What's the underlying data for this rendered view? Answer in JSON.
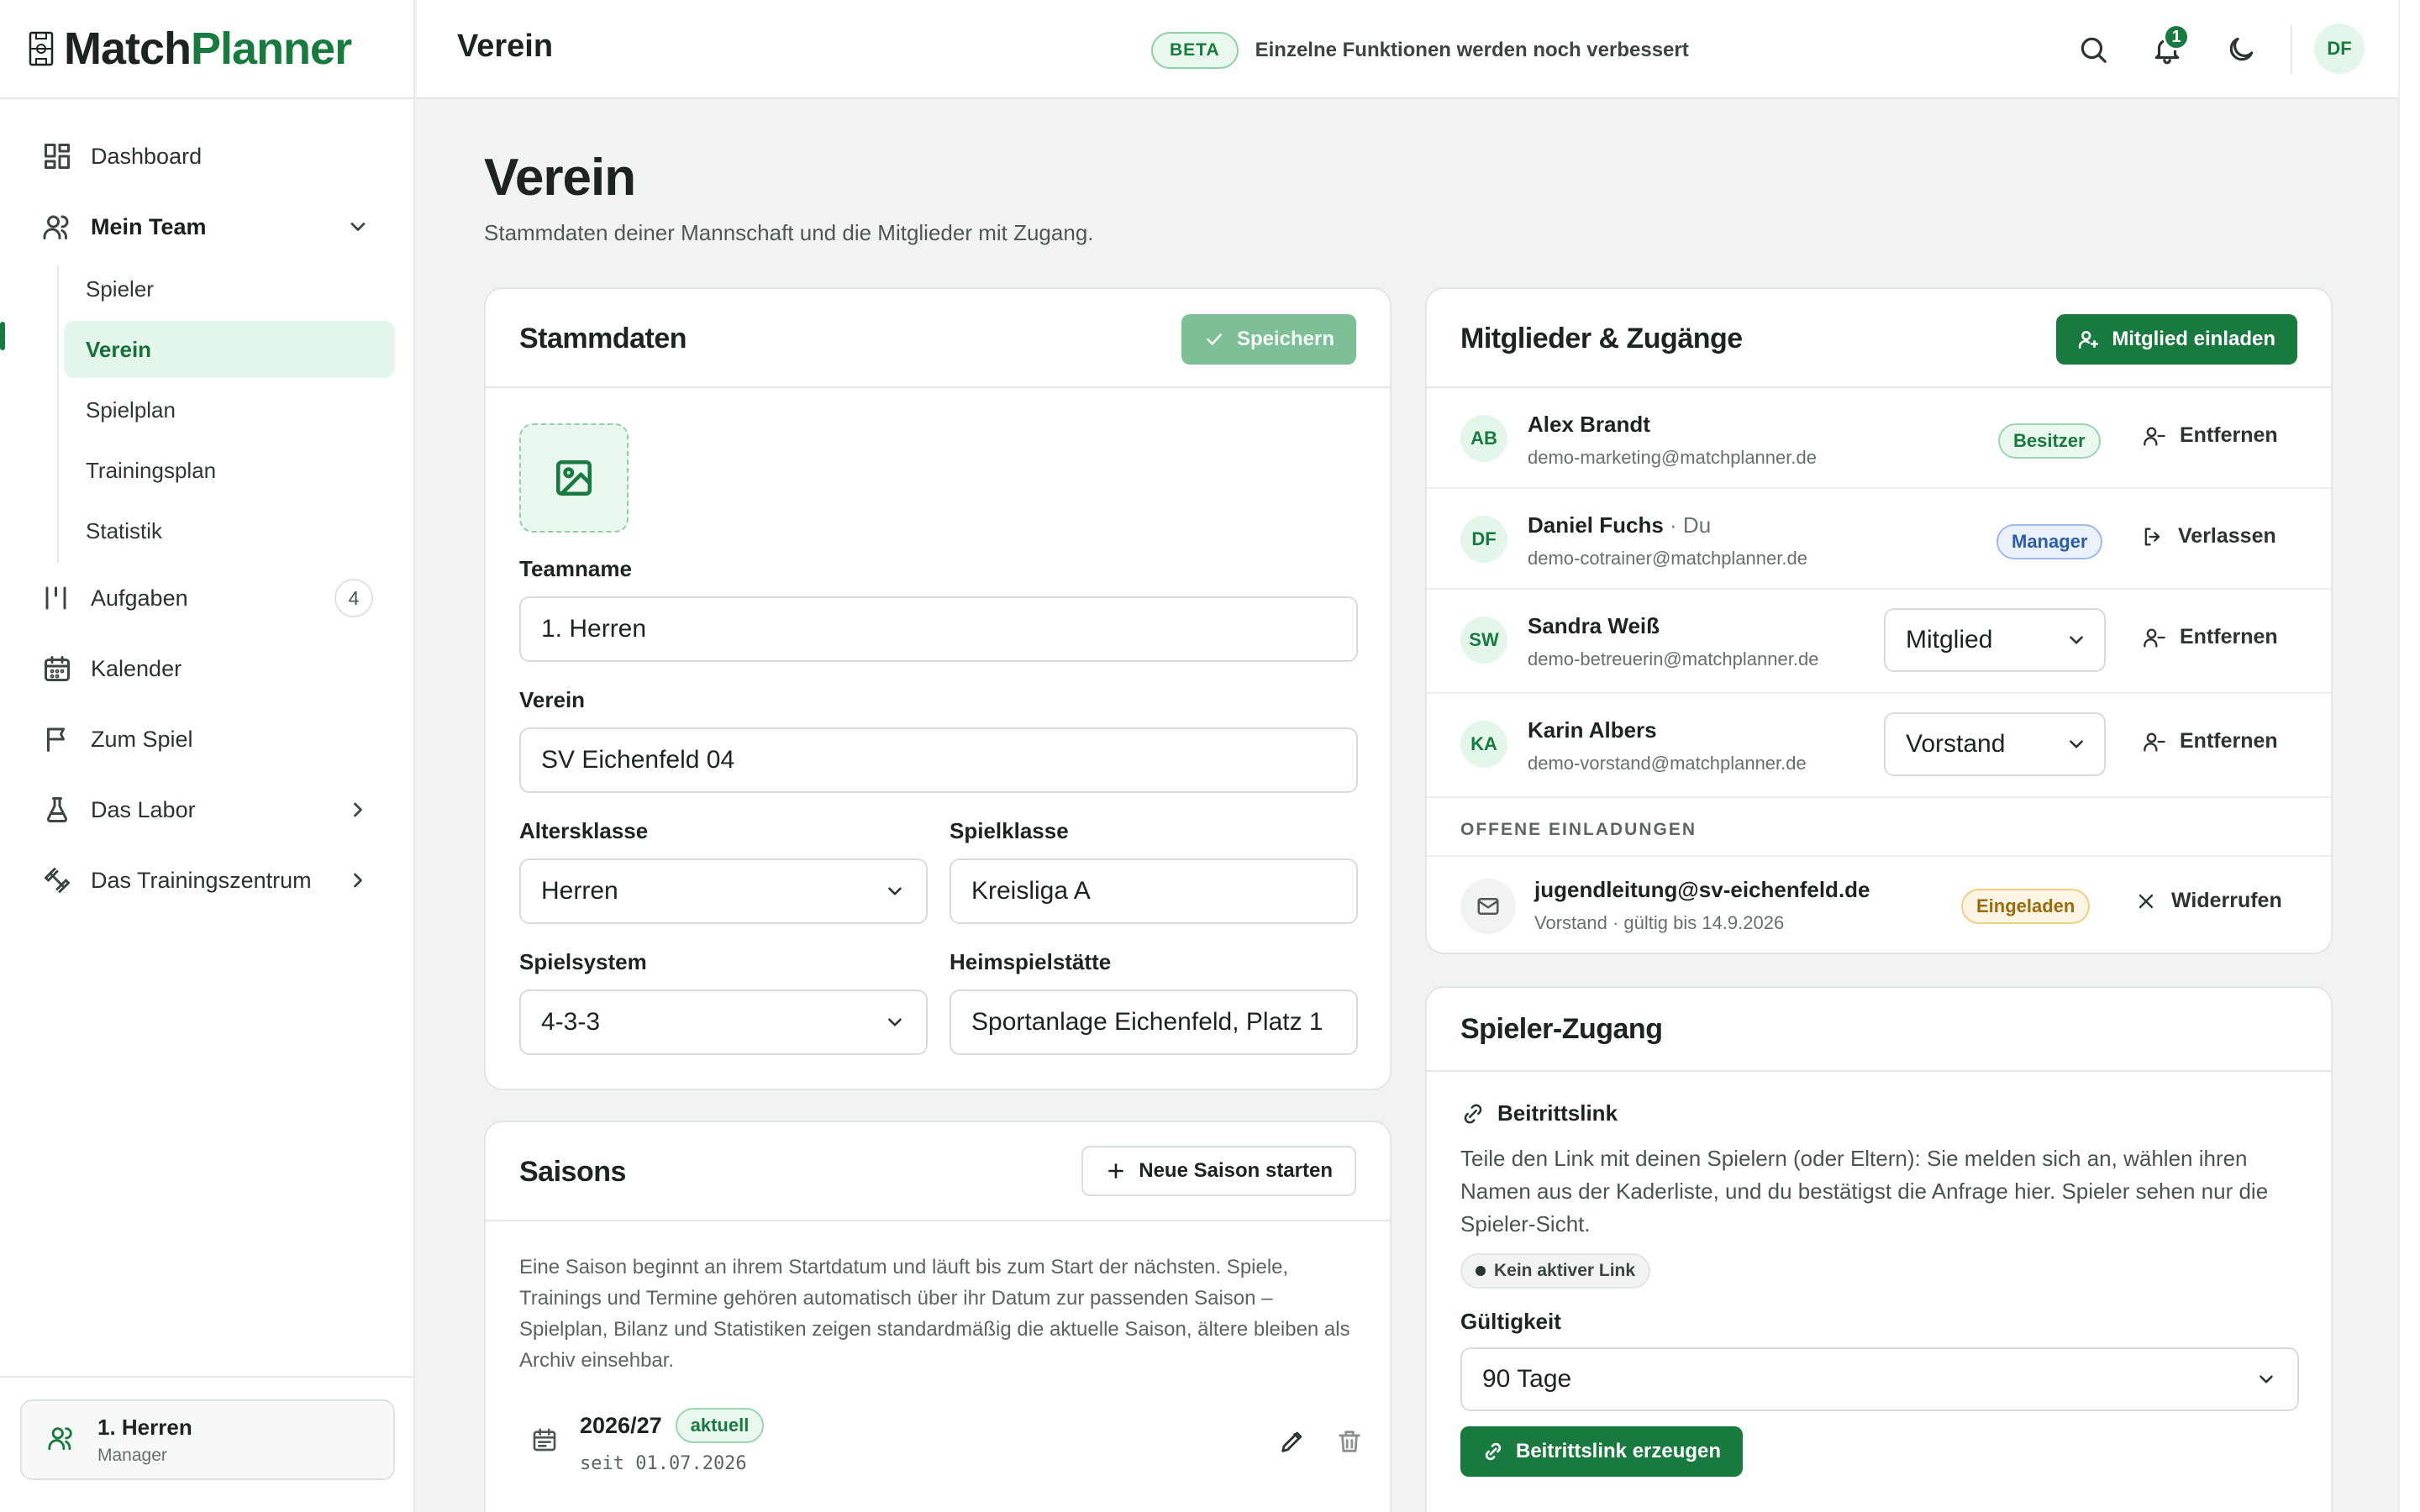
{
  "brand": {
    "part1": "Match",
    "part2": "Planner"
  },
  "topbar": {
    "title": "Verein",
    "beta_label": "BETA",
    "beta_text": "Einzelne Funktionen werden noch verbessert",
    "notification_count": "1",
    "user_initials": "DF",
    "icons": [
      "search-icon",
      "bell-icon",
      "moon-icon"
    ]
  },
  "sidebar": {
    "nav": {
      "dashboard": "Dashboard",
      "mein_team": "Mein Team",
      "aufgaben": "Aufgaben",
      "aufgaben_count": "4",
      "kalender": "Kalender",
      "zum_spiel": "Zum Spiel",
      "labor": "Das Labor",
      "trainingszentrum": "Das Trainingszentrum"
    },
    "subnav": [
      "Spieler",
      "Verein",
      "Spielplan",
      "Trainingsplan",
      "Statistik"
    ],
    "active_subnav": "Verein",
    "team_switch": {
      "name": "1. Herren",
      "role": "Manager"
    }
  },
  "page": {
    "title": "Verein",
    "subtitle": "Stammdaten deiner Mannschaft und die Mitglieder mit Zugang."
  },
  "stammdaten": {
    "title": "Stammdaten",
    "save_label": "Speichern",
    "fields": {
      "teamname_label": "Teamname",
      "teamname_value": "1. Herren",
      "verein_label": "Verein",
      "verein_value": "SV Eichenfeld 04",
      "altersklasse_label": "Altersklasse",
      "altersklasse_value": "Herren",
      "spielklasse_label": "Spielklasse",
      "spielklasse_value": "Kreisliga A",
      "spielsystem_label": "Spielsystem",
      "spielsystem_value": "4-3-3",
      "heimspielstaette_label": "Heimspielstätte",
      "heimspielstaette_value": "Sportanlage Eichenfeld, Platz 1"
    }
  },
  "saisons": {
    "title": "Saisons",
    "new_label": "Neue Saison starten",
    "description": "Eine Saison beginnt an ihrem Startdatum und läuft bis zum Start der nächsten. Spiele, Trainings und Termine gehören automatisch über ihr Datum zur passenden Saison – Spielplan, Bilanz und Statistiken zeigen standardmäßig die aktuelle Saison, ältere bleiben als Archiv einsehbar.",
    "items": [
      {
        "name": "2026/27",
        "tag": "aktuell",
        "since": "seit 01.07.2026"
      }
    ]
  },
  "members": {
    "title": "Mitglieder & Zugänge",
    "invite_label": "Mitglied einladen",
    "rows": [
      {
        "initials": "AB",
        "name": "Alex Brandt",
        "suffix": "",
        "email": "demo-marketing@matchplanner.de",
        "role": "Besitzer",
        "action": "Entfernen"
      },
      {
        "initials": "DF",
        "name": "Daniel Fuchs",
        "suffix": " · Du",
        "email": "demo-cotrainer@matchplanner.de",
        "role": "Manager",
        "action": "Verlassen"
      },
      {
        "initials": "SW",
        "name": "Sandra Weiß",
        "suffix": "",
        "email": "demo-betreuerin@matchplanner.de",
        "role": "Mitglied",
        "action": "Entfernen"
      },
      {
        "initials": "KA",
        "name": "Karin Albers",
        "suffix": "",
        "email": "demo-vorstand@matchplanner.de",
        "role": "Vorstand",
        "action": "Entfernen"
      }
    ],
    "open_invites_label": "OFFENE EINLADUNGEN",
    "invites": [
      {
        "email": "jugendleitung@sv-eichenfeld.de",
        "meta": "Vorstand · gültig bis 14.9.2026",
        "status": "Eingeladen",
        "action": "Widerrufen"
      }
    ]
  },
  "player_access": {
    "title": "Spieler-Zugang",
    "link_heading": "Beitrittslink",
    "description": "Teile den Link mit deinen Spielern (oder Eltern): Sie melden sich an, wählen ihren Namen aus der Kaderliste, und du bestätigst die Anfrage hier. Spieler sehen nur die Spieler-Sicht.",
    "status": "Kein aktiver Link",
    "validity_label": "Gültigkeit",
    "validity_value": "90 Tage",
    "generate_label": "Beitrittslink erzeugen"
  },
  "colors": {
    "accent": "#187a3f",
    "accent_light": "#e4f5ea",
    "manager_blue": "#2b5ea8",
    "invited_amber": "#9a6a0d"
  }
}
